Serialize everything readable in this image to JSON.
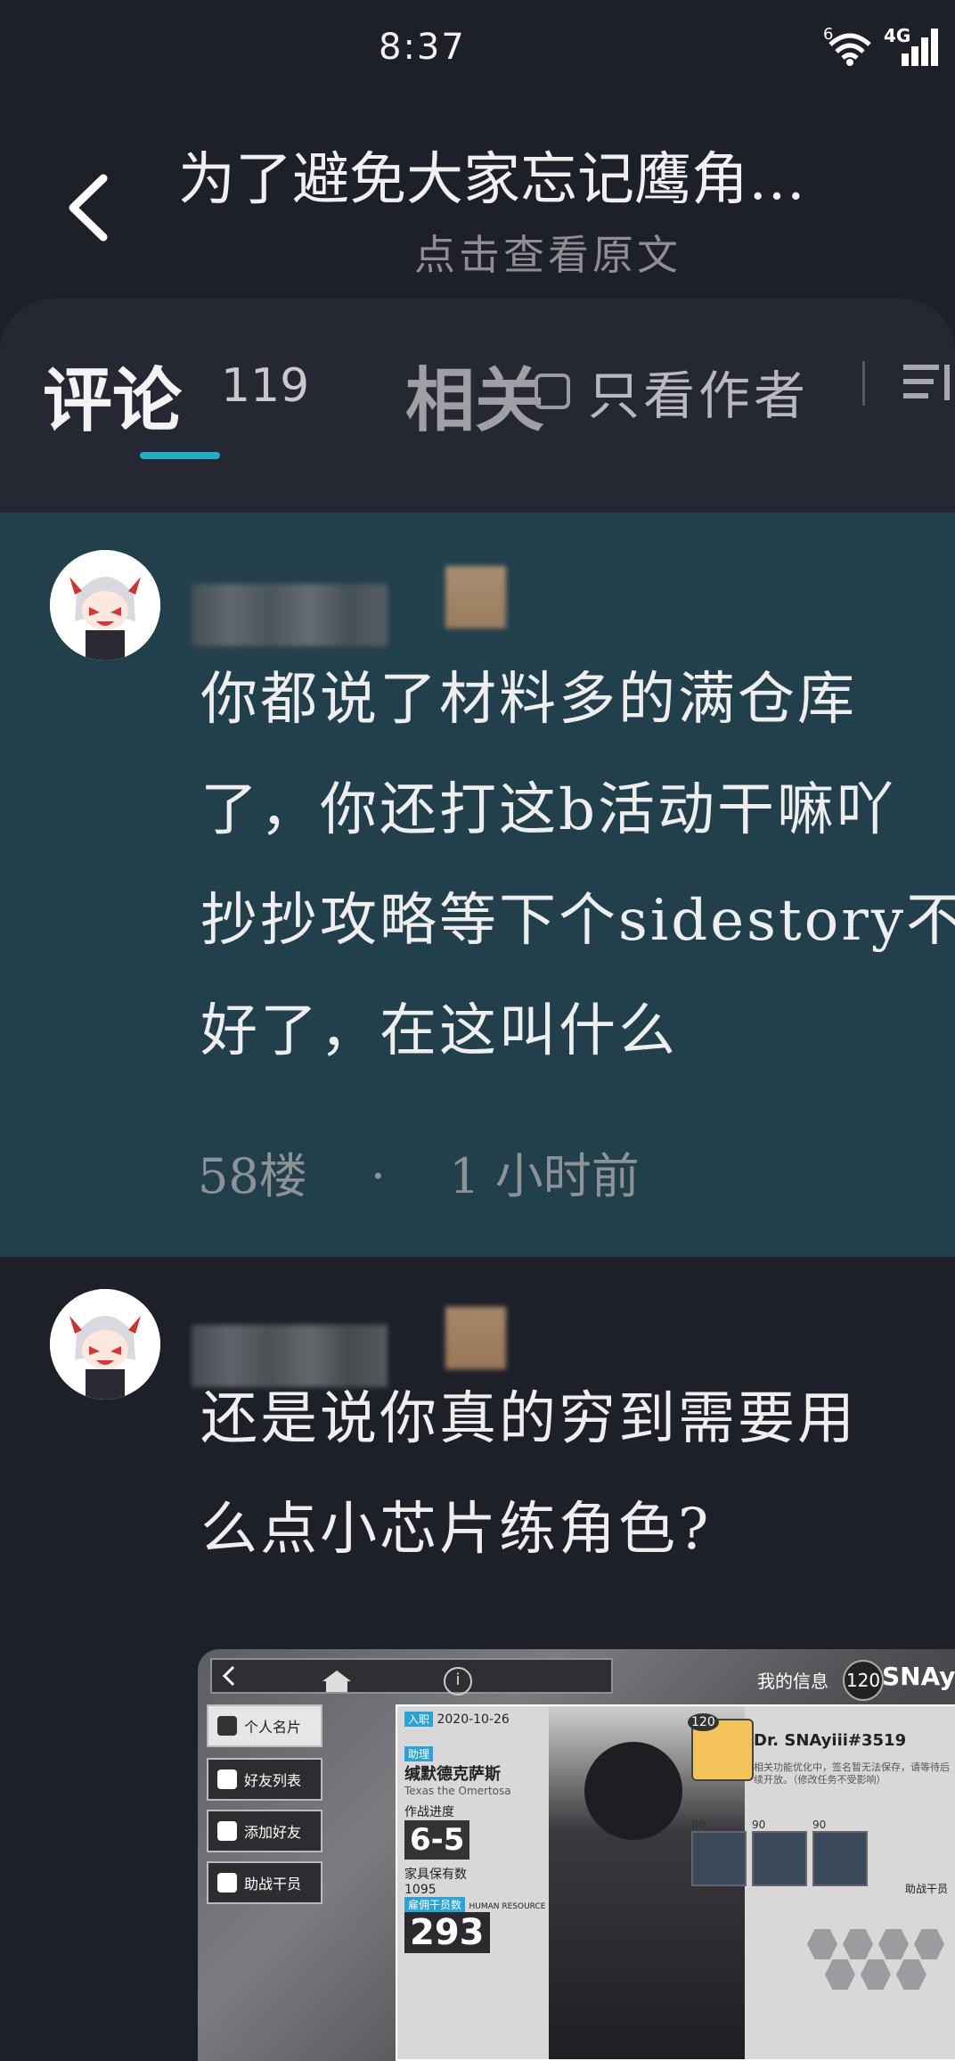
{
  "status_bar": {
    "time": "8:37",
    "network": "4G",
    "wifi_badge": "6"
  },
  "header": {
    "title": "为了避免大家忘记鹰角…",
    "subtitle": "点击查看原文"
  },
  "tabs": {
    "comments_label": "评论",
    "comments_count": "119",
    "related_label": "相关",
    "author_only_label": "只看作者"
  },
  "comments": [
    {
      "text": "你都说了材料多的满仓库\n了，你还打这b活动干嘛吖\n抄抄攻略等下个sidestory不\n好了，在这叫什么",
      "floor": "58楼",
      "separator": "·",
      "time": "1 小时前"
    },
    {
      "text": "还是说你真的穷到需要用\n么点小芯片练角色?"
    }
  ],
  "screenshot_attachment": {
    "my_info": "我的信息",
    "level": "120",
    "username": "SNAyii",
    "menu": [
      "个人名片",
      "好友列表",
      "添加好友",
      "助战干员"
    ],
    "join_tag": "入职",
    "join_date": "2020-10-26",
    "assistant_tag": "助理",
    "operator_cn": "缄默德克萨斯",
    "operator_en": "Texas the Omertosa",
    "progress_label": "作战进度",
    "progress_value": "6-5",
    "furniture_label": "家具保有数",
    "furniture_value": "1095",
    "hr_tag": "雇佣干员数",
    "hr_sub": "HUMAN RESOURCE",
    "operators_value": "293",
    "dr_name": "Dr. SNAyiii#3519",
    "dr_note": "相关功能优化中，签名暂无法保存，请等待后续开放。（修改任务不受影响）",
    "dr_level": "120",
    "support_levels": [
      "80",
      "90",
      "90"
    ],
    "support_label": "助战干员"
  },
  "colors": {
    "accent": "#1fb0c9",
    "background": "#1e2029",
    "highlight": "#22404c"
  }
}
